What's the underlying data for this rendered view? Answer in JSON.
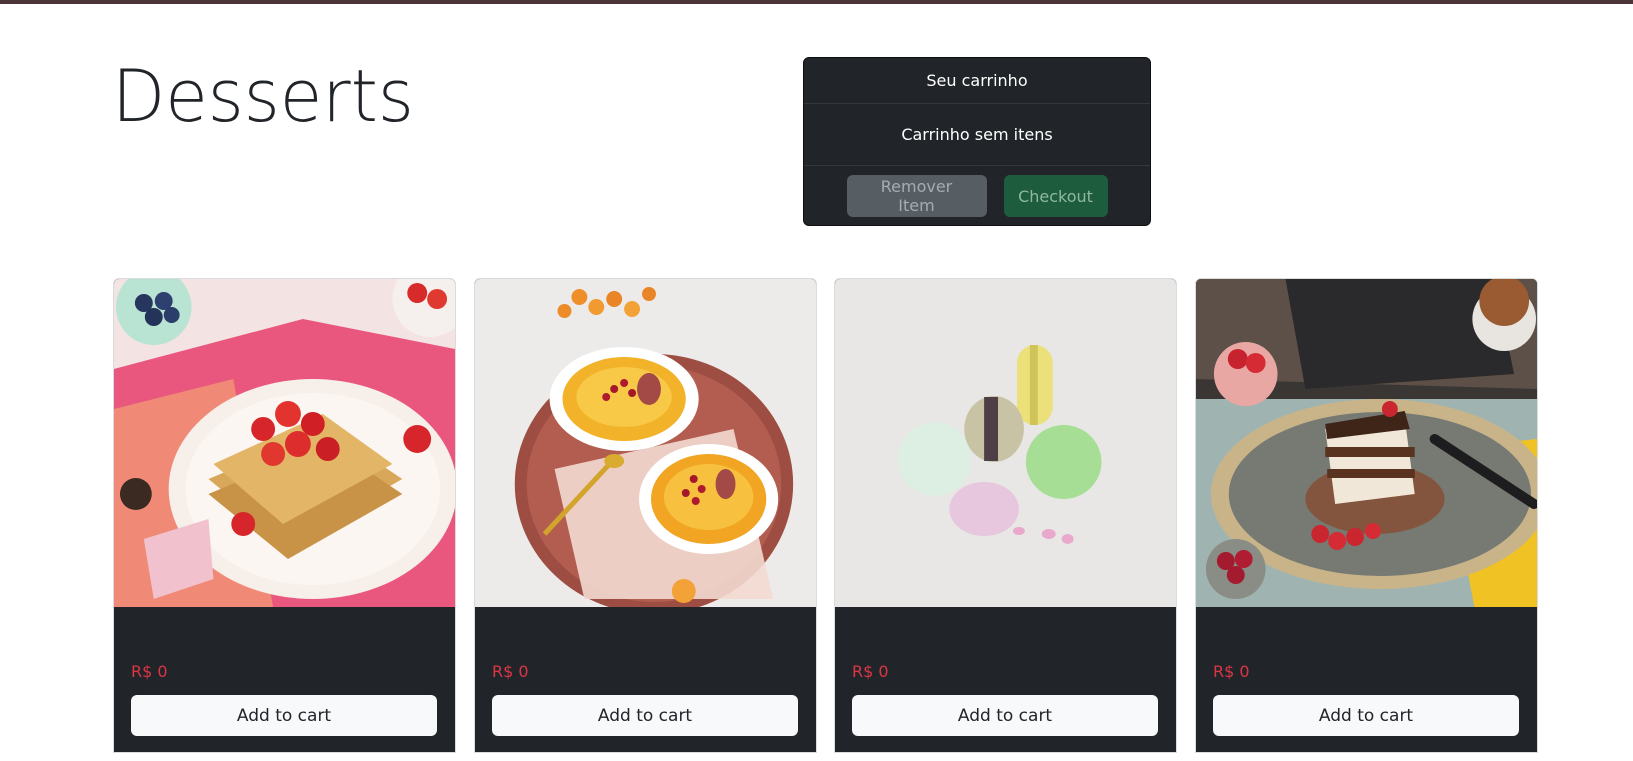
{
  "page": {
    "title": "Desserts"
  },
  "cart": {
    "title": "Seu carrinho",
    "empty_text": "Carrinho sem itens",
    "remove_label": "Remover Item",
    "checkout_label": "Checkout"
  },
  "products": [
    {
      "price": "R$ 0",
      "add_label": "Add to cart"
    },
    {
      "price": "R$ 0",
      "add_label": "Add to cart"
    },
    {
      "price": "R$ 0",
      "add_label": "Add to cart"
    },
    {
      "price": "R$ 0",
      "add_label": "Add to cart"
    }
  ],
  "colors": {
    "dark": "#212529",
    "price": "#dc3545",
    "remove_button": "#565e64",
    "checkout_button": "#1d5c3d",
    "add_button": "#f8f9fa"
  }
}
